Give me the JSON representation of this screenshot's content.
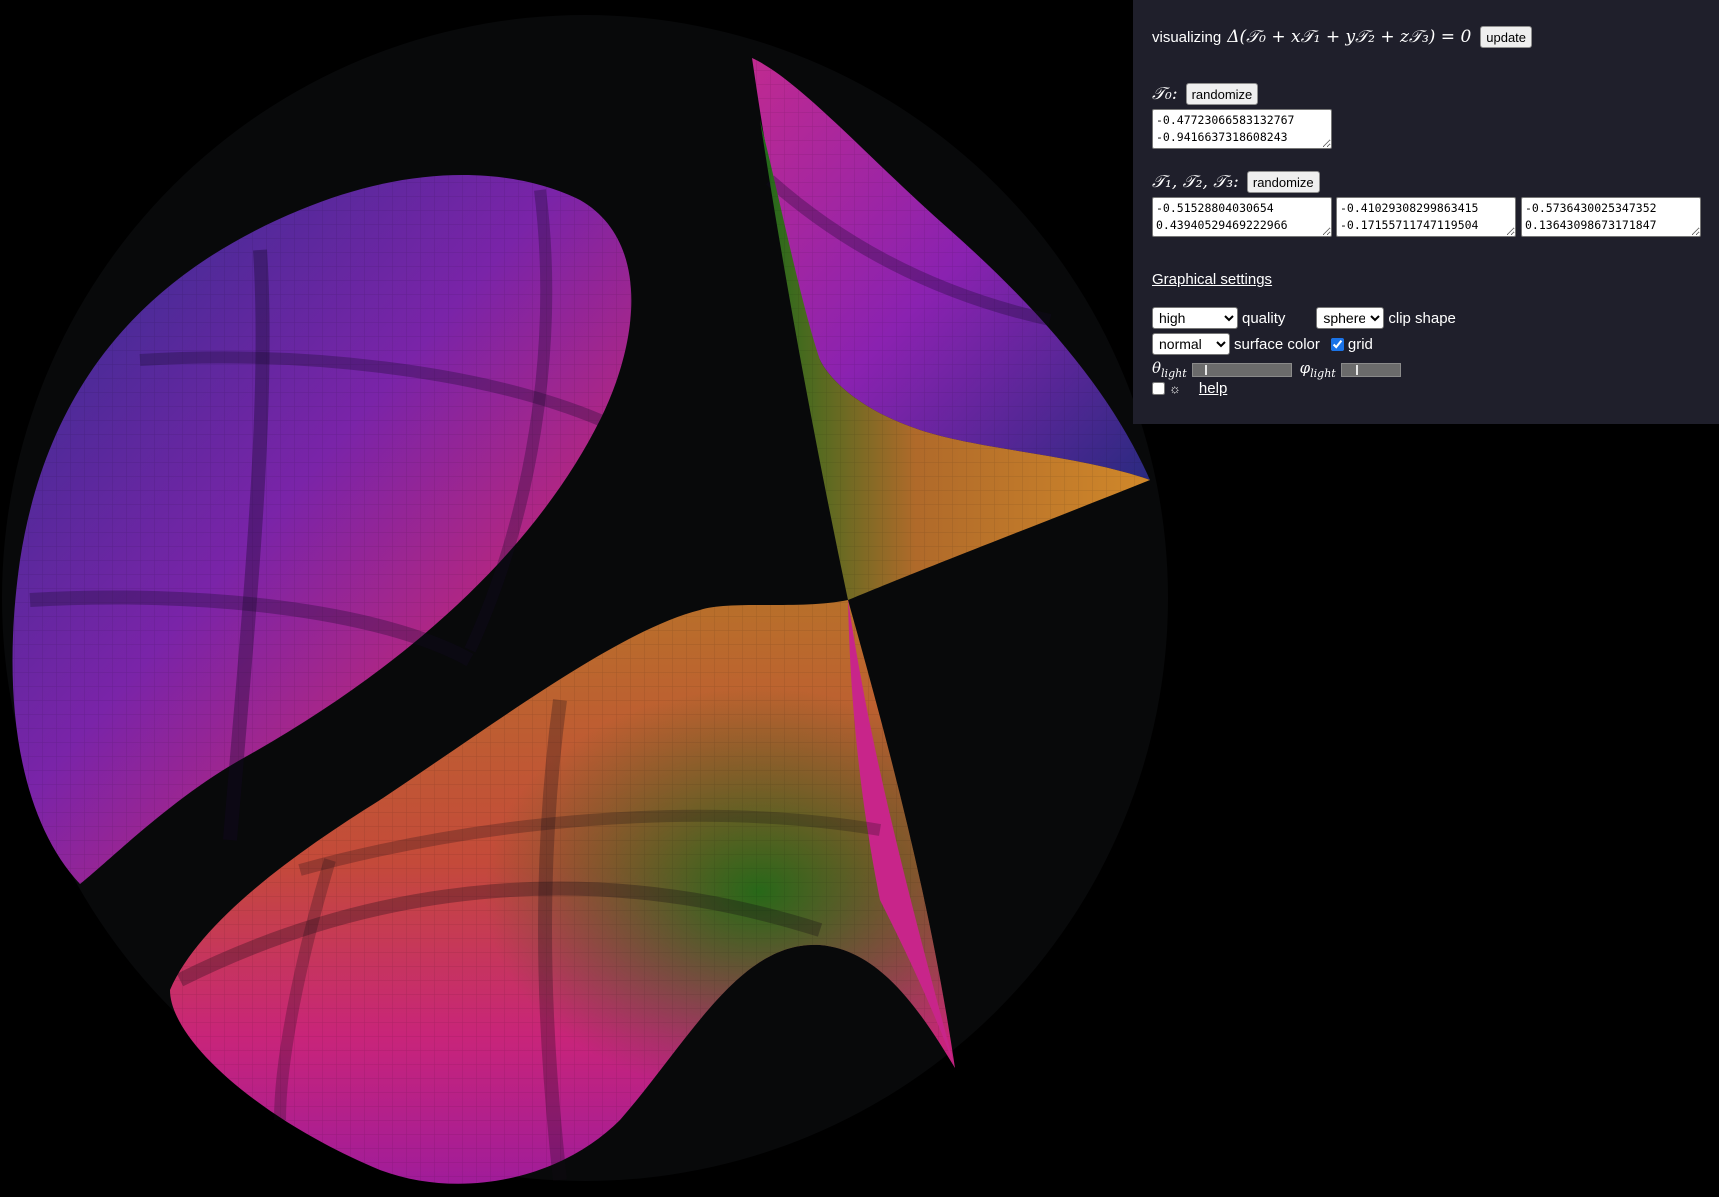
{
  "header": {
    "prefix": "visualizing",
    "equation": "Δ(𝒯₀ + x𝒯₁ + y𝒯₂ + z𝒯₃) = 0",
    "update_label": "update"
  },
  "t0": {
    "label": "𝒯₀:",
    "randomize_label": "randomize",
    "value": "-0.47723066583132767\n-0.9416637318608243"
  },
  "t123": {
    "label": "𝒯₁, 𝒯₂, 𝒯₃:",
    "randomize_label": "randomize",
    "values": [
      "-0.51528804030654\n0.43940529469222966",
      "-0.41029308299863415\n-0.17155711747119504",
      "-0.5736430025347352\n0.13643098673171847"
    ]
  },
  "graphics": {
    "title": "Graphical settings",
    "quality": {
      "selected": "high",
      "label": "quality"
    },
    "clip_shape": {
      "selected": "sphere",
      "label": "clip shape"
    },
    "surface_color": {
      "selected": "normal",
      "label": "surface color"
    },
    "grid": {
      "label": "grid",
      "checked": true
    },
    "theta_light": {
      "symbol": "θ",
      "subscript": "light",
      "value": 0.12
    },
    "phi_light": {
      "symbol": "φ",
      "subscript": "light",
      "value": 0.25
    },
    "sun": {
      "symbol": "☼",
      "checked": false
    },
    "help_label": "help"
  },
  "colors": {
    "panel_bg": "#1f1f2b",
    "canvas_bg": "#000000",
    "sphere_bg": "#08090a",
    "surface_magenta": "#c0208a",
    "surface_purple": "#6a1fa0",
    "surface_blue": "#2a2a8a",
    "surface_orange": "#c0602a",
    "surface_green": "#2f7a1a"
  }
}
